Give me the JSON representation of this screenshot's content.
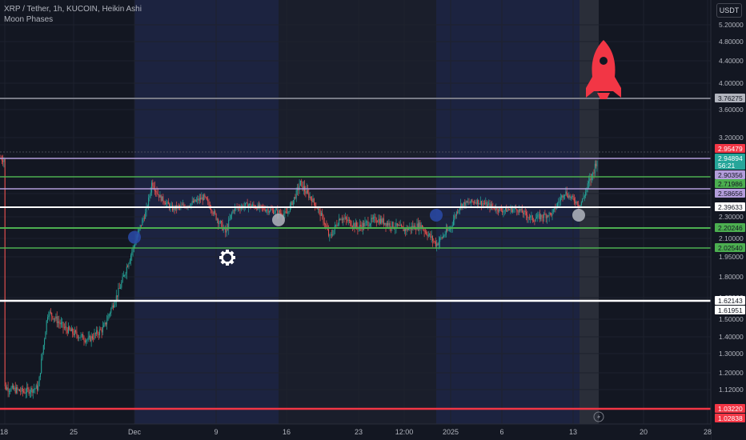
{
  "header": {
    "symbol_line": "XRP / Tether, 1h, KUCOIN, Heikin Ashi",
    "indicator": "Moon Phases"
  },
  "currency": "USDT",
  "colors": {
    "background": "#131722",
    "grid": "#1e222d",
    "up": "#26a69a",
    "down": "#ef5350",
    "white_line": "#ffffff",
    "green_line": "#4caf50",
    "purple_line": "#b39ddb",
    "red_line": "#f23645",
    "gray_line": "#787b86",
    "rocket": "#f23645",
    "moon_new": "#2962ff",
    "moon_full": "#b2b5be"
  },
  "chart_data": {
    "type": "candlestick",
    "x_tick_labels": [
      "18",
      "25",
      "Dec",
      "9",
      "16",
      "23",
      "12:00",
      "2025",
      "6",
      "13",
      "20",
      "28"
    ],
    "y_tick_labels": [
      "5.20000",
      "4.80000",
      "4.40000",
      "4.00000",
      "3.60000",
      "3.20000",
      "2.60000",
      "2.30000",
      "2.10000",
      "1.95000",
      "1.80000",
      "1.65000",
      "1.50000",
      "1.40000",
      "1.30000",
      "1.20000",
      "1.12000"
    ],
    "ylim": [
      1.02,
      5.5
    ],
    "y_scale": "log",
    "series": [
      {
        "points": [
          [
            "18",
            1.13
          ],
          [
            "25",
            1.42
          ],
          [
            "Dec",
            2.05
          ],
          [
            "9",
            2.3
          ],
          [
            "16",
            2.33
          ],
          [
            "23",
            2.2
          ],
          [
            "12:00",
            2.18
          ],
          [
            "2025",
            2.2
          ],
          [
            "6",
            2.38
          ],
          [
            "13",
            2.52
          ]
        ],
        "last": 2.95479
      }
    ],
    "horizontal_levels": [
      {
        "value": 3.76275,
        "label": "3.76275",
        "color": "gray"
      },
      {
        "value": 2.95479,
        "label": "2.95479",
        "color": "red-last"
      },
      {
        "value": 2.94894,
        "label": "2.94894",
        "color": "teal"
      },
      {
        "value": 2.90356,
        "label": "2.90356",
        "color": "purple"
      },
      {
        "value": 2.71986,
        "label": "2.71986",
        "color": "green"
      },
      {
        "value": 2.58656,
        "label": "2.58656",
        "color": "purple"
      },
      {
        "value": 2.39633,
        "label": "2.39633",
        "color": "white"
      },
      {
        "value": 2.20246,
        "label": "2.20246",
        "color": "green"
      },
      {
        "value": 2.0254,
        "label": "2.02540",
        "color": "green"
      },
      {
        "value": 1.62143,
        "label": "1.62143",
        "color": "white"
      },
      {
        "value": 1.61951,
        "label": "1.61951",
        "color": "white"
      },
      {
        "value": 1.0322,
        "label": "1.03220",
        "color": "red"
      },
      {
        "value": 1.02838,
        "label": "1.02838",
        "color": "red"
      }
    ],
    "countdown_label": "56:21",
    "moon_phase_markers": [
      {
        "phase": "new",
        "at": "Dec",
        "value": 2.11
      },
      {
        "phase": "full",
        "at": "16",
        "value": 2.27
      },
      {
        "phase": "new",
        "at": "2025",
        "value": 2.32
      },
      {
        "phase": "full",
        "at": "13",
        "value": 2.32
      }
    ],
    "icons": [
      "rocket-icon",
      "gear-icon",
      "lightning-icon"
    ]
  }
}
